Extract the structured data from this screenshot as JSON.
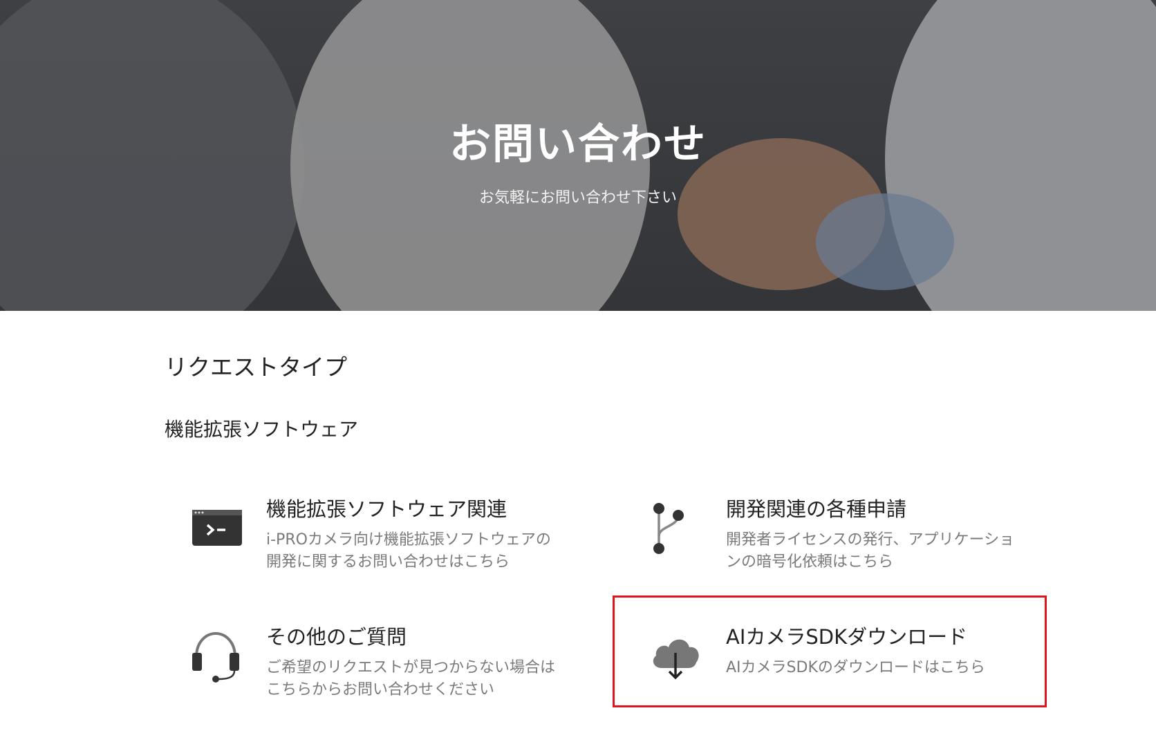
{
  "hero": {
    "title": "お問い合わせ",
    "subtitle": "お気軽にお問い合わせ下さい"
  },
  "section": {
    "title": "リクエストタイプ",
    "subtitle": "機能拡張ソフトウェア"
  },
  "cards": [
    {
      "icon": "terminal-icon",
      "title": "機能拡張ソフトウェア関連",
      "desc_line1": "i-PROカメラ向け機能拡張ソフトウェアの",
      "desc_line2": "開発に関するお問い合わせはこちら"
    },
    {
      "icon": "branch-icon",
      "title": "開発関連の各種申請",
      "desc_line1": "開発者ライセンスの発行、アプリケーショ",
      "desc_line2": "ンの暗号化依頼はこちら"
    },
    {
      "icon": "headset-icon",
      "title": "その他のご質問",
      "desc_line1": "ご希望のリクエストが見つからない場合は",
      "desc_line2": "こちらからお問い合わせください"
    },
    {
      "icon": "cloud-download-icon",
      "title": "AIカメラSDKダウンロード",
      "desc_line1": "AIカメラSDKのダウンロードはこちら",
      "desc_line2": ""
    }
  ],
  "colors": {
    "highlight": "#e0141e",
    "text_primary": "#222222",
    "text_secondary": "#7a7a7a",
    "icon": "#333333"
  }
}
